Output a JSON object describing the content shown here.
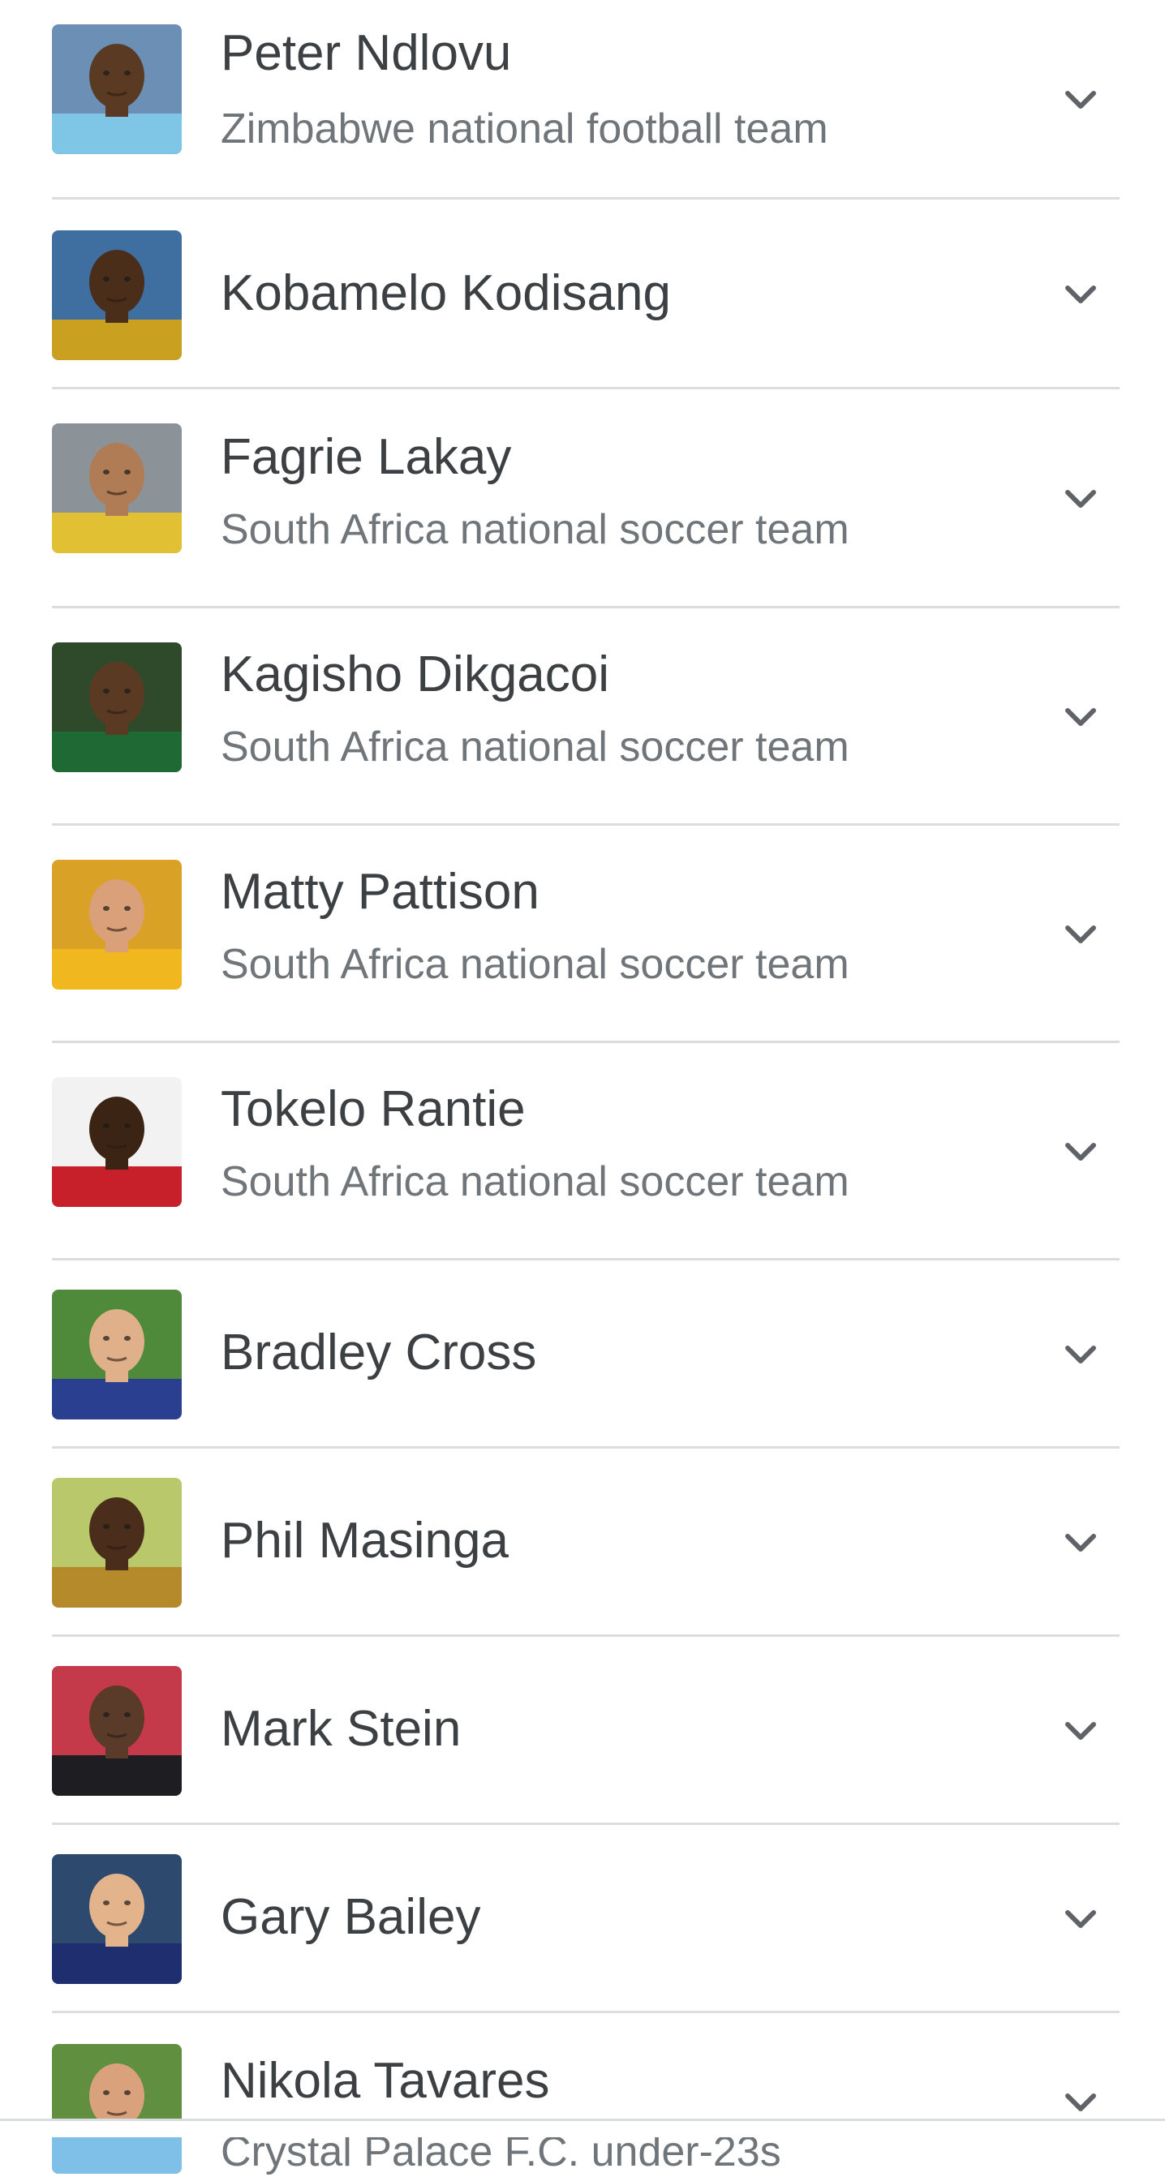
{
  "results": [
    {
      "name": "Peter Ndlovu",
      "subtitle": "Zimbabwe national football team",
      "avatar": {
        "bg": "#6b8fb5",
        "skin": "#5a3a22",
        "shirt": "#7fc6e6"
      }
    },
    {
      "name": "Kobamelo Kodisang",
      "subtitle": "",
      "avatar": {
        "bg": "#3f6ea0",
        "skin": "#4a2e1a",
        "shirt": "#c9a020"
      }
    },
    {
      "name": "Fagrie Lakay",
      "subtitle": "South Africa national soccer team",
      "avatar": {
        "bg": "#8c9398",
        "skin": "#b07c55",
        "shirt": "#e2c034"
      }
    },
    {
      "name": "Kagisho Dikgacoi",
      "subtitle": "South Africa national soccer team",
      "avatar": {
        "bg": "#2f4a2a",
        "skin": "#5b3a24",
        "shirt": "#1f6a34"
      }
    },
    {
      "name": "Matty Pattison",
      "subtitle": "South Africa national soccer team",
      "avatar": {
        "bg": "#d9a126",
        "skin": "#d9a07a",
        "shirt": "#f0b81e"
      }
    },
    {
      "name": "Tokelo Rantie",
      "subtitle": "South Africa national soccer team",
      "avatar": {
        "bg": "#f2f2f2",
        "skin": "#3b2414",
        "shirt": "#c8202a"
      }
    },
    {
      "name": "Bradley Cross",
      "subtitle": "",
      "avatar": {
        "bg": "#4f8a3a",
        "skin": "#e0b08a",
        "shirt": "#2a3f8f"
      }
    },
    {
      "name": "Phil Masinga",
      "subtitle": "",
      "avatar": {
        "bg": "#b9c86a",
        "skin": "#4a2d1a",
        "shirt": "#b58a2a"
      }
    },
    {
      "name": "Mark Stein",
      "subtitle": "",
      "avatar": {
        "bg": "#c43a4a",
        "skin": "#5a3a28",
        "shirt": "#1e1e22"
      }
    },
    {
      "name": "Gary Bailey",
      "subtitle": "",
      "avatar": {
        "bg": "#2d4a6e",
        "skin": "#e3b48c",
        "shirt": "#1f2e6e"
      }
    },
    {
      "name": "Nikola Tavares",
      "subtitle": "Crystal Palace F.C. under-23s",
      "avatar": {
        "bg": "#5f8f3f",
        "skin": "#d9a27c",
        "shirt": "#7fc0e8"
      }
    }
  ],
  "icons": {
    "expand": "chevron-down-icon"
  },
  "colors": {
    "name_text": "#3c4043",
    "subtitle_text": "#70757a",
    "divider": "#dadce0",
    "chevron": "#5f6368"
  }
}
